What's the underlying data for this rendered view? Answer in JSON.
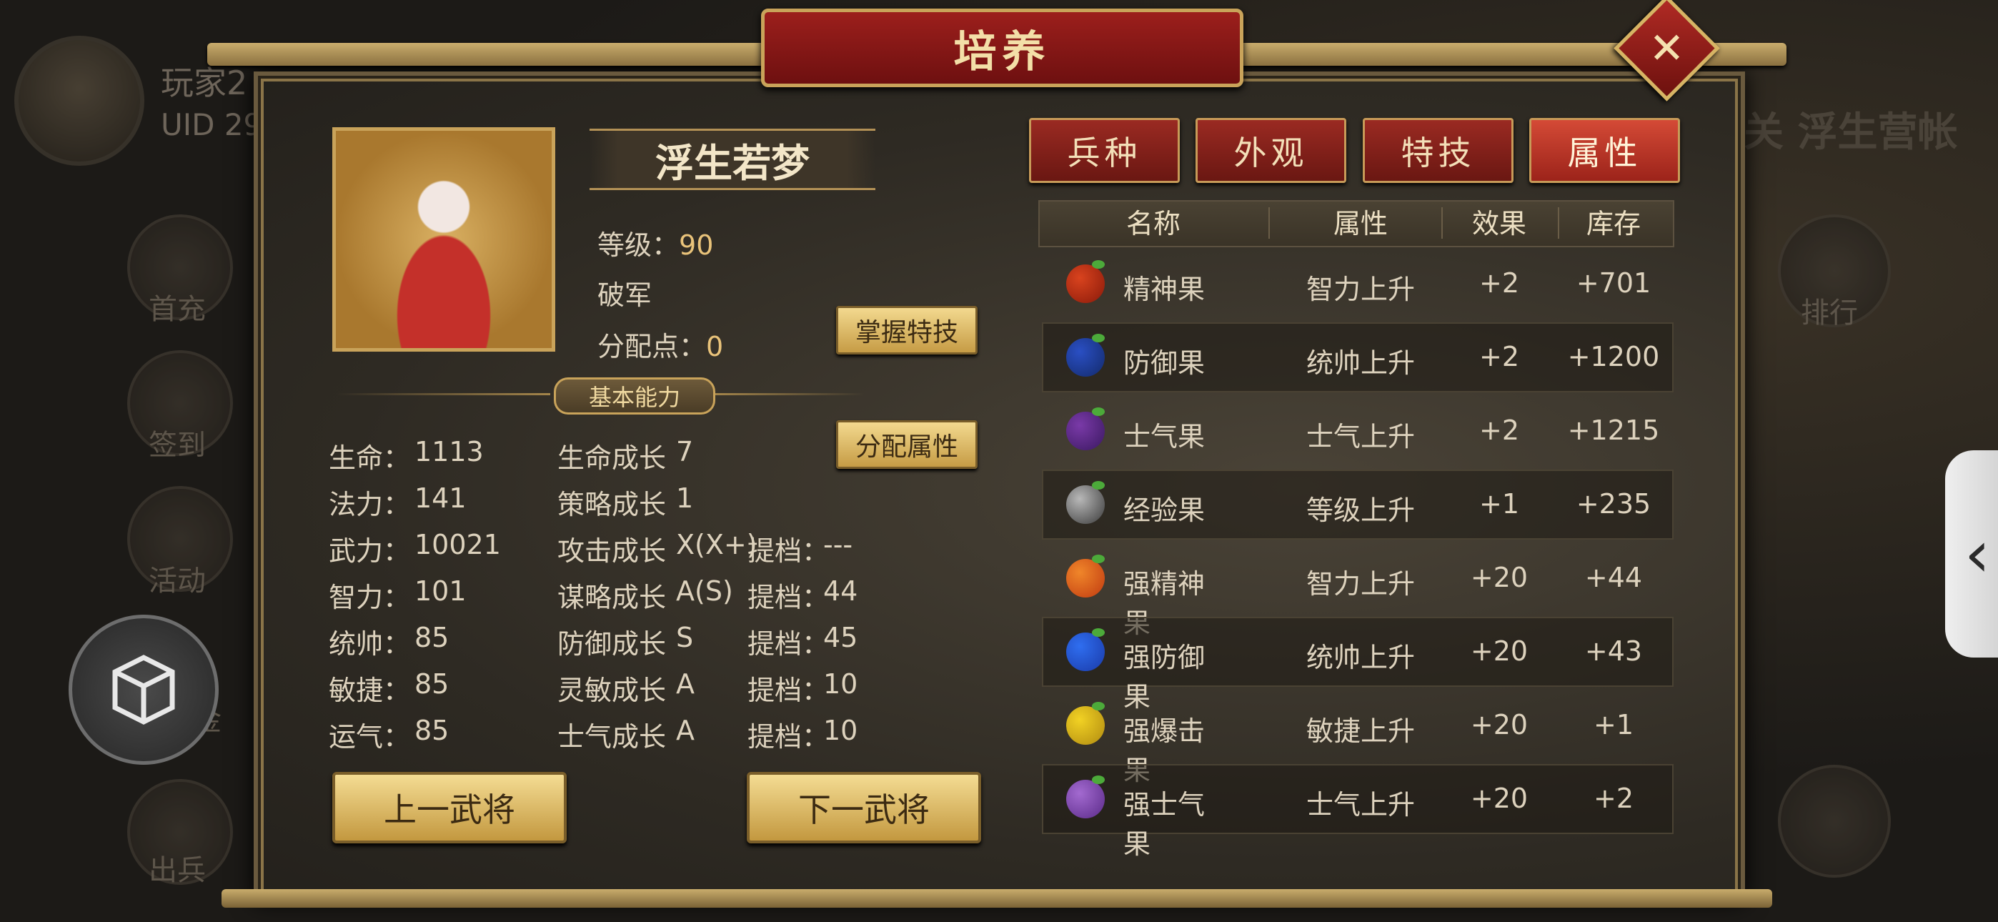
{
  "background": {
    "player_label": "玩家2",
    "uid_label": "UID  29",
    "side_buttons": [
      "首充",
      "签到",
      "活动",
      "基金",
      "出兵"
    ],
    "right_text": "关 浮生营帐",
    "right_button": "排行"
  },
  "title": "培养",
  "close_icon": "close-icon",
  "hero": {
    "name": "浮生若梦",
    "level_label": "等级：",
    "level_value": "90",
    "class_label": "破军",
    "points_label": "分配点：",
    "points_value": "0",
    "master_skill_button": "掌握特技",
    "assign_button": "分配属性",
    "section_title": "基本能力"
  },
  "stats": [
    {
      "label": "生命：",
      "value": "1113",
      "growth_label": "生命成长",
      "growth_value": "7",
      "upgrade_label": "",
      "upgrade_value": ""
    },
    {
      "label": "法力：",
      "value": "141",
      "growth_label": "策略成长",
      "growth_value": "1",
      "upgrade_label": "",
      "upgrade_value": ""
    },
    {
      "label": "武力：",
      "value": "10021",
      "growth_label": "攻击成长",
      "growth_value": "X(X+)",
      "upgrade_label": "提档：",
      "upgrade_value": "---"
    },
    {
      "label": "智力：",
      "value": "101",
      "growth_label": "谋略成长",
      "growth_value": "A(S)",
      "upgrade_label": "提档：",
      "upgrade_value": "44"
    },
    {
      "label": "统帅：",
      "value": "85",
      "growth_label": "防御成长",
      "growth_value": "S",
      "upgrade_label": "提档：",
      "upgrade_value": "45"
    },
    {
      "label": "敏捷：",
      "value": "85",
      "growth_label": "灵敏成长",
      "growth_value": "A",
      "upgrade_label": "提档：",
      "upgrade_value": "10"
    },
    {
      "label": "运气：",
      "value": "85",
      "growth_label": "士气成长",
      "growth_value": "A",
      "upgrade_label": "提档：",
      "upgrade_value": "10"
    }
  ],
  "nav": {
    "prev_button": "上一武将",
    "next_button": "下一武将"
  },
  "tabs": [
    {
      "label": "兵种",
      "active": false
    },
    {
      "label": "外观",
      "active": false
    },
    {
      "label": "特技",
      "active": false
    },
    {
      "label": "属性",
      "active": true
    }
  ],
  "table": {
    "headers": [
      "名称",
      "属性",
      "效果",
      "库存"
    ],
    "rows": [
      {
        "icon": "spirit-fruit-icon",
        "name": "精神果",
        "attr": "智力上升",
        "effect": "+2",
        "stock": "+701"
      },
      {
        "icon": "defense-fruit-icon",
        "name": "防御果",
        "attr": "统帅上升",
        "effect": "+2",
        "stock": "+1200"
      },
      {
        "icon": "morale-fruit-icon",
        "name": "士气果",
        "attr": "士气上升",
        "effect": "+2",
        "stock": "+1215"
      },
      {
        "icon": "exp-fruit-icon",
        "name": "经验果",
        "attr": "等级上升",
        "effect": "+1",
        "stock": "+235"
      },
      {
        "icon": "strong-spirit-fruit-icon",
        "name": "强精神果",
        "attr": "智力上升",
        "effect": "+20",
        "stock": "+44"
      },
      {
        "icon": "strong-defense-fruit-icon",
        "name": "强防御果",
        "attr": "统帅上升",
        "effect": "+20",
        "stock": "+43"
      },
      {
        "icon": "strong-crit-fruit-icon",
        "name": "强爆击果",
        "attr": "敏捷上升",
        "effect": "+20",
        "stock": "+1"
      },
      {
        "icon": "strong-morale-fruit-icon",
        "name": "强士气果",
        "attr": "士气上升",
        "effect": "+20",
        "stock": "+2"
      }
    ]
  },
  "colors": {
    "gold": "#e9c37a",
    "red": "#f04a34",
    "green": "#6fdc5a",
    "tab_red": "#9a2a22"
  }
}
